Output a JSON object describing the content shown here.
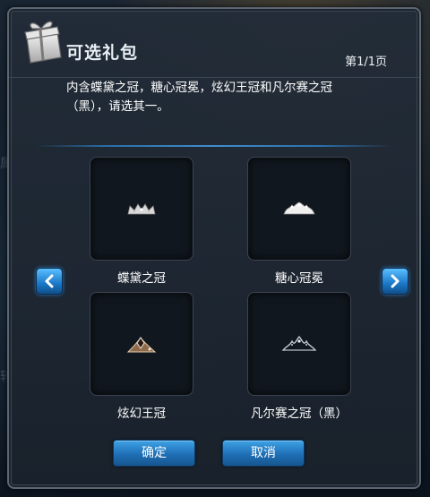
{
  "dialog": {
    "title": "可选礼包",
    "page_indicator": "第1/1页",
    "description": "内含蝶黛之冠，糖心冠冕，炫幻王冠和凡尔赛之冠（黑），请选其一。"
  },
  "items": [
    {
      "name": "蝶黛之冠",
      "icon": "tiara-icon"
    },
    {
      "name": "糖心冠冕",
      "icon": "crown-icon"
    },
    {
      "name": "炫幻王冠",
      "icon": "gem-tiara-icon"
    },
    {
      "name": "凡尔赛之冠（黑）",
      "icon": "dark-tiara-icon"
    }
  ],
  "buttons": {
    "confirm": "确定",
    "cancel": "取消"
  },
  "colors": {
    "panel": "#222c38",
    "accent_blue": "#1f6fb6",
    "text": "#ffffff"
  }
}
